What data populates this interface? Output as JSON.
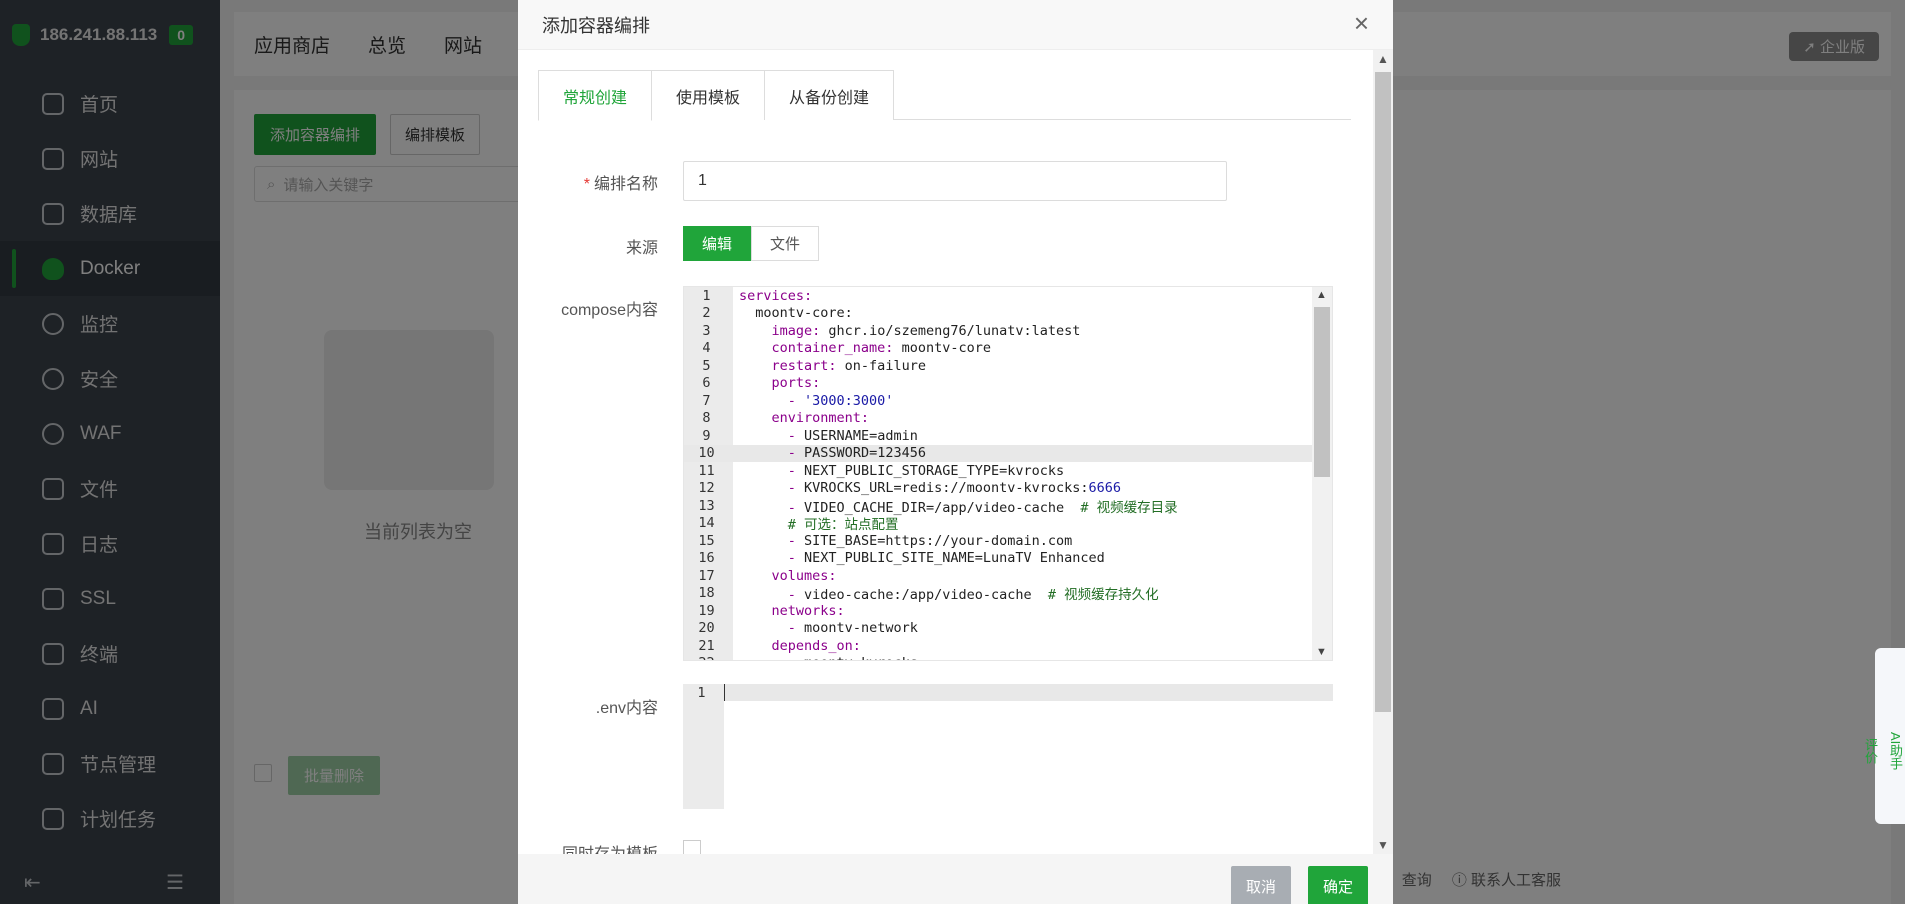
{
  "sidebar": {
    "ip": "186.241.88.113",
    "badge": "0",
    "items": [
      {
        "label": "首页",
        "icon": "home-icon"
      },
      {
        "label": "网站",
        "icon": "website-icon"
      },
      {
        "label": "数据库",
        "icon": "database-icon"
      },
      {
        "label": "Docker",
        "icon": "docker-icon"
      },
      {
        "label": "监控",
        "icon": "monitor-icon"
      },
      {
        "label": "安全",
        "icon": "shield-icon"
      },
      {
        "label": "WAF",
        "icon": "waf-icon"
      },
      {
        "label": "文件",
        "icon": "folder-icon"
      },
      {
        "label": "日志",
        "icon": "log-icon"
      },
      {
        "label": "SSL",
        "icon": "ssl-icon"
      },
      {
        "label": "终端",
        "icon": "terminal-icon"
      },
      {
        "label": "AI",
        "icon": "ai-icon"
      },
      {
        "label": "节点管理",
        "icon": "node-icon"
      },
      {
        "label": "计划任务",
        "icon": "calendar-icon"
      }
    ],
    "active": "Docker"
  },
  "topbar": {
    "tabs": [
      "应用商店",
      "总览",
      "网站"
    ],
    "enterprise": "企业版"
  },
  "content": {
    "add_button": "添加容器编排",
    "template_button": "编排模板",
    "search_placeholder": "请输入关键字",
    "empty_text": "当前列表为空",
    "bulk_delete": "批量删除",
    "footer_links": [
      "查询",
      "联系人工客服"
    ]
  },
  "helper": {
    "ai": "AI助手",
    "review": "评价"
  },
  "modal": {
    "title": "添加容器编排",
    "tabs": [
      "常规创建",
      "使用模板",
      "从备份创建"
    ],
    "name_label": "编排名称",
    "name_value": "1",
    "source_label": "来源",
    "source_options": [
      "编辑",
      "文件"
    ],
    "compose_label": "compose内容",
    "env_label": ".env内容",
    "save_template_label": "同时存为模板",
    "cancel": "取消",
    "confirm": "确定",
    "compose_lines": [
      "services:",
      "  moontv-core:",
      "    image: ghcr.io/szemeng76/lunatv:latest",
      "    container_name: moontv-core",
      "    restart: on-failure",
      "    ports:",
      "      - '3000:3000'",
      "    environment:",
      "      - USERNAME=admin",
      "      - PASSWORD=123456",
      "      - NEXT_PUBLIC_STORAGE_TYPE=kvrocks",
      "      - KVROCKS_URL=redis://moontv-kvrocks:6666",
      "      - VIDEO_CACHE_DIR=/app/video-cache  # 视频缓存目录",
      "      # 可选：站点配置",
      "      - SITE_BASE=https://your-domain.com",
      "      - NEXT_PUBLIC_SITE_NAME=LunaTV Enhanced",
      "    volumes:",
      "      - video-cache:/app/video-cache  # 视频缓存持久化",
      "    networks:",
      "      - moontv-network",
      "    depends_on:",
      "      - moontv-kvrocks"
    ],
    "highlighted_line": 10,
    "env_lines": [
      ""
    ]
  },
  "colors": {
    "brand_green": "#20a53a",
    "sidebar_bg": "#3c444d"
  }
}
